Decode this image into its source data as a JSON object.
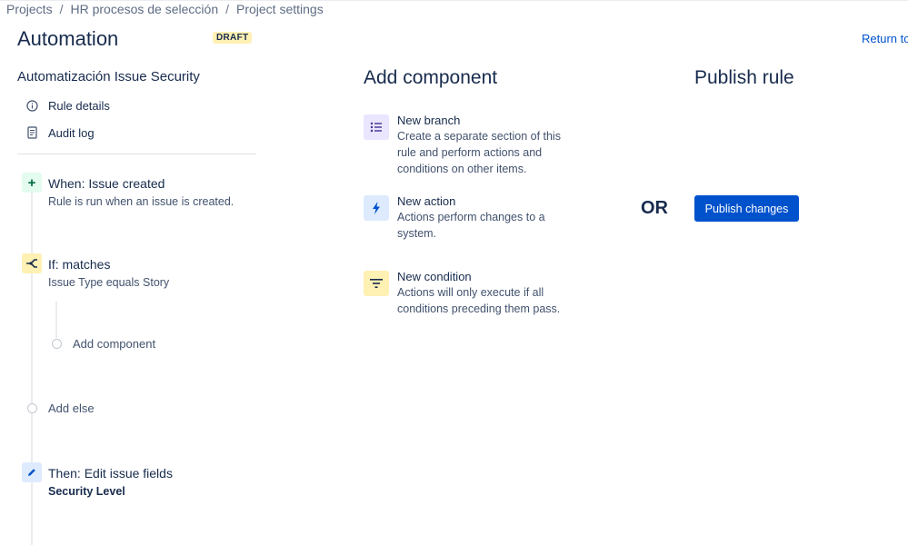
{
  "breadcrumb": {
    "items": [
      "Projects",
      "HR procesos de selección",
      "Project settings"
    ],
    "separator": "/"
  },
  "header": {
    "title": "Automation",
    "badge": "DRAFT",
    "return_link": "Return to"
  },
  "sidebar": {
    "rule_name": "Automatización Issue Security",
    "links": [
      "Rule details",
      "Audit log"
    ]
  },
  "rule": {
    "trigger": {
      "title": "When: Issue created",
      "description": "Rule is run when an issue is created.",
      "icon": "plus-icon"
    },
    "condition": {
      "title": "If: matches",
      "description": "Issue Type equals Story",
      "icon": "condition-branch-icon"
    },
    "add_component": "Add component",
    "add_else": "Add else",
    "action": {
      "title": "Then: Edit issue fields",
      "description": "Security Level",
      "icon": "pencil-icon"
    }
  },
  "add_component_panel": {
    "heading": "Add component",
    "items": [
      {
        "title": "New branch",
        "description": "Create a separate section of this rule and perform actions and conditions on other items.",
        "icon": "list-icon"
      },
      {
        "title": "New action",
        "description": "Actions perform changes to a system.",
        "icon": "lightning-icon"
      },
      {
        "title": "New condition",
        "description": "Actions will only execute if all conditions preceding them pass.",
        "icon": "filter-icon"
      }
    ]
  },
  "publish_panel": {
    "heading": "Publish rule",
    "or_text": "OR",
    "button_label": "Publish changes"
  },
  "colors": {
    "brand": "#0052cc",
    "text": "#172b4d",
    "badge_bg": "#fff0b3",
    "trigger_bg": "#e3fcef",
    "branch_bg": "#eae6ff"
  }
}
